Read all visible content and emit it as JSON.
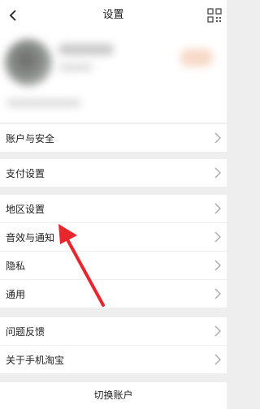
{
  "nav": {
    "title": "设置",
    "back_icon": "chevron-left-icon",
    "qr_icon": "qr-code-icon"
  },
  "profile": {
    "note": ""
  },
  "menu": {
    "group1": [
      "账户与安全"
    ],
    "group2": [
      "支付设置"
    ],
    "group3": [
      "地区设置",
      "音效与通知",
      "隐私",
      "通用"
    ],
    "group4": [
      "问题反馈",
      "关于手机淘宝"
    ]
  },
  "footer": {
    "switch_account": "切换账户"
  },
  "annotation": {
    "arrow_color": "#e8262b",
    "points_to": "音效与通知"
  }
}
